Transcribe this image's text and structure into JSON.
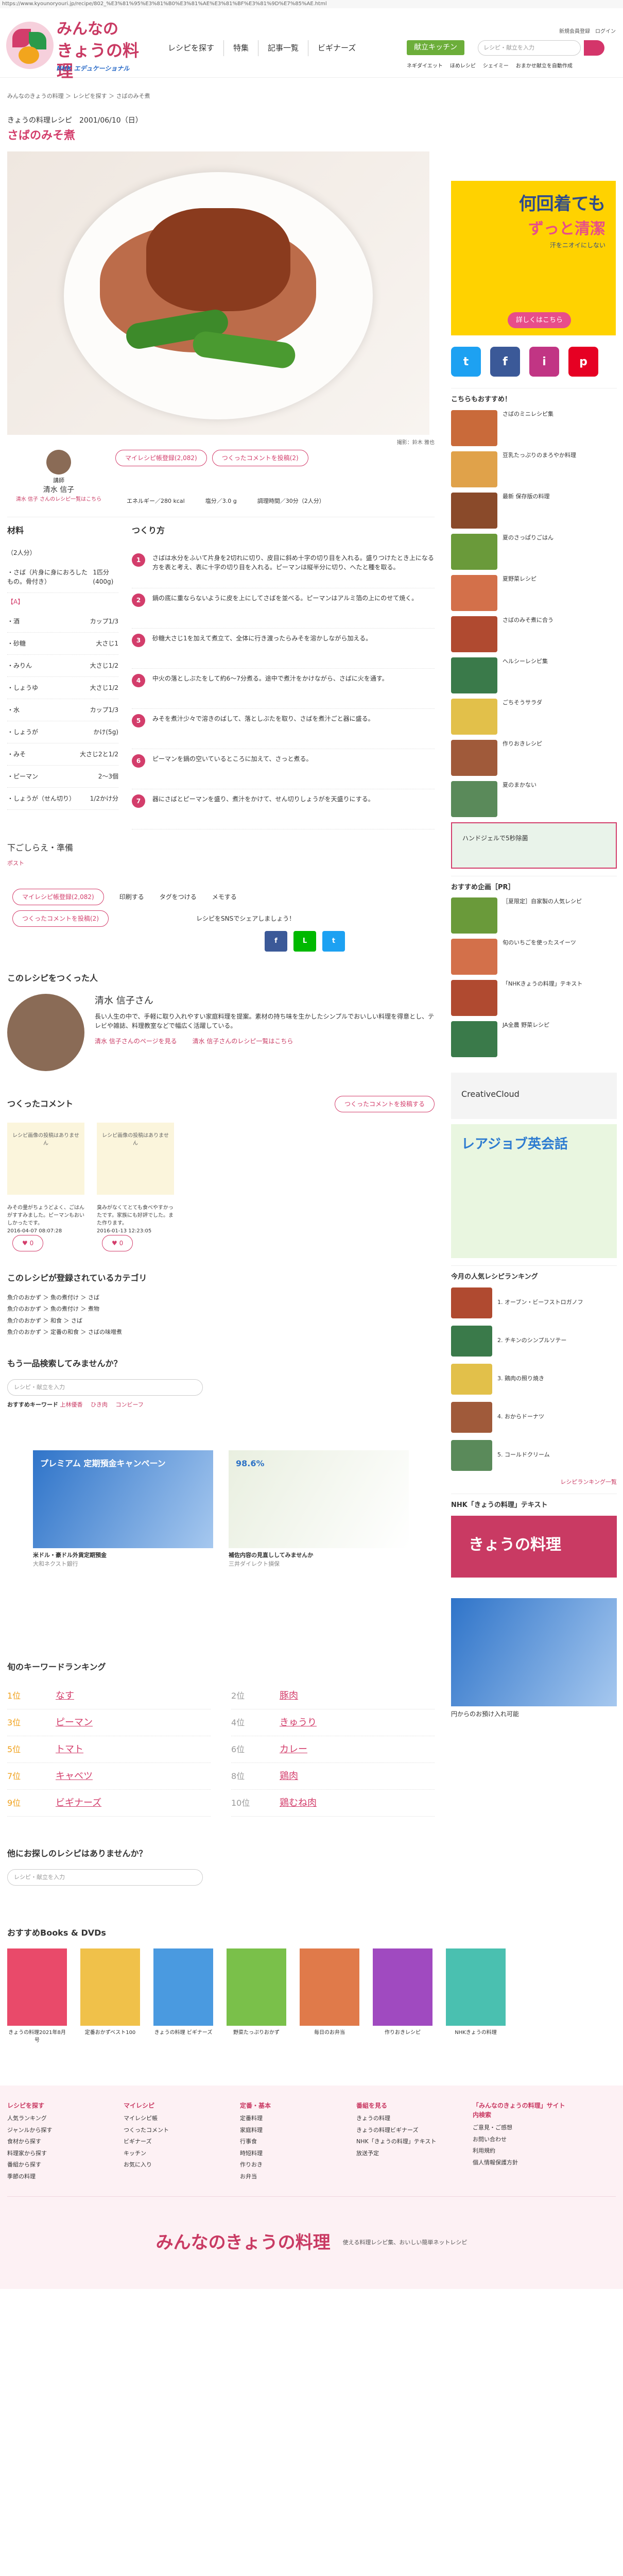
{
  "browser": {
    "url": "https://www.kyounoryouri.jp/recipe/802_%E3%81%95%E3%81%B0%E3%81%AE%E3%81%BF%E3%81%9D%E7%85%AE.html"
  },
  "header": {
    "logo_line1": "みんなの",
    "logo_line2": "きょうの料理",
    "logo_nhk": "NHK エデュケーショナル",
    "nav": [
      "レシピを探す",
      "特集",
      "記事一覧",
      "ビギナーズ"
    ],
    "top_links": "新規会員登録　ログイン",
    "kitchen_btn": "献立キッチン",
    "search_placeholder": "レシピ・献立を入力",
    "sub_links": [
      "ネギダイエット",
      "ほめレシピ",
      "シェイミー",
      "おまかせ献立を自動作成"
    ]
  },
  "breadcrumb": "みんなのきょうの料理 ＞ レシピを探す ＞ さばのみそ煮",
  "recipe": {
    "kind": "きょうの料理レシピ　2001/06/10（日）",
    "title": "さばのみそ煮",
    "photo_credit": "撮影：鈴木 雅也",
    "cook_label": "講師",
    "cook_name": "清水 信子",
    "cook_link": "清水 信子 さんのレシピ一覧はこちら",
    "fav_btn": "マイレシピ帳登録(2,082)",
    "comment_btn": "つくったコメントを投稿(2)",
    "energy": "エネルギー／280 kcal",
    "salt": "塩分／3.0 g",
    "time": "調理時間／30分（2人分）",
    "ingredients_title": "材料",
    "servings": "（2人分）",
    "ingredients": [
      {
        "name": "・さば（片身に身におろしたもの。骨付き）",
        "qty": "1匹分(400g)"
      },
      {
        "group": "【A】"
      },
      {
        "name": "・酒",
        "qty": "カップ1/3"
      },
      {
        "name": "・砂糖",
        "qty": "大さじ1"
      },
      {
        "name": "・みりん",
        "qty": "大さじ1/2"
      },
      {
        "name": "・しょうゆ",
        "qty": "大さじ1/2"
      },
      {
        "name": "・水",
        "qty": "カップ1/3"
      },
      {
        "name": "・しょうが",
        "qty": "かけ(5g)"
      },
      {
        "name": "・みそ",
        "qty": "大さじ2と1/2"
      },
      {
        "name": "・ピーマン",
        "qty": "2〜3個"
      },
      {
        "name": "・しょうが（せん切り）",
        "qty": "1/2かけ分"
      }
    ],
    "steps_title": "つくり方",
    "steps": [
      "さばは水分をふいて片身を2切れに切り、皮目に斜め十字の切り目を入れる。盛りつけたとき上になる方を表と考え、表に十字の切り目を入れる。ピーマンは縦半分に切り、へたと種を取る。",
      "鍋の底に重ならないように皮を上にしてさばを並べる。ピーマンはアルミ箔の上にのせて焼く。",
      "砂糖大さじ1を加えて煮立て、全体に行き渡ったらみそを溶かしながら加える。",
      "中火の落としぶたをして約6〜7分煮る。途中で煮汁をかけながら、さばに火を通す。",
      "みそを煮汁少々で溶きのばして、落としぶたを取り、さばを煮汁ごと器に盛る。",
      "ピーマンを鍋の空いているところに加えて、さっと煮る。",
      "器にさばとピーマンを盛り、煮汁をかけて、せん切りしょうがを天盛りにする。"
    ],
    "prep_title": "下ごしらえ・準備",
    "prep_link": "ポスト"
  },
  "actions": {
    "fav": "マイレシピ帳登録(2,082)",
    "comment": "つくったコメントを投稿(2)",
    "print": "印刷する",
    "tag": "タグをつける",
    "memo": "メモする",
    "share_label": "レシピをSNSでシェアしましょう！"
  },
  "author_section": {
    "title": "このレシピをつくった人",
    "name": "清水 信子さん",
    "bio": "長い人生の中で、手軽に取り入れやすい家庭料理を提案。素材の持ち味を生かしたシンプルでおいしい料理を得意とし、テレビや雑誌、料理教室などで幅広く活躍している。",
    "link1": "清水 信子さんのページを見る",
    "link2": "清水 信子さんのレシピ一覧はこちら"
  },
  "comments": {
    "title": "つくったコメント",
    "btn": "つくったコメントを投稿する",
    "items": [
      {
        "card": "レシピ画像の投稿はありません",
        "body": "みその量がちょうどよく、ごはんがすすみました。ピーマンもおいしかったです。",
        "date": "2016-04-07 08:07:28",
        "like": "0"
      },
      {
        "card": "レシピ画像の投稿はありません",
        "body": "臭みがなくてとても食べやすかったです。家族にも好評でした。また作ります。",
        "date": "2016-01-13 12:23:05",
        "like": "0"
      }
    ]
  },
  "categories": {
    "title": "このレシピが登録されているカテゴリ",
    "items": [
      "魚介のおかず ＞ 魚の煮付け ＞ さば",
      "魚介のおかず ＞ 魚の煮付け ＞ 煮物",
      "魚介のおかず ＞ 和食 ＞ さば",
      "魚介のおかず ＞ 定番の和食 ＞ さばの味噌煮"
    ]
  },
  "search_again": {
    "title": "もう一品検索してみませんか？",
    "placeholder": "レシピ・献立を入力",
    "kw_label": "おすすめキーワード",
    "kws": [
      "上林優香",
      "ひき肉",
      "コンビーフ"
    ]
  },
  "ads": [
    {
      "head": "プレミアム 定期預金キャンペーン",
      "caption": "米ドル・豪ドル外貨定期預金",
      "src": "大和ネクスト銀行"
    },
    {
      "head": "98.6%",
      "caption": "補佐内容の見直ししてみませんか",
      "src": "三井ダイレクト損保"
    }
  ],
  "ranking": {
    "title": "旬のキーワードランキング",
    "items": [
      {
        "no": "1位",
        "kw": "なす"
      },
      {
        "no": "2位",
        "kw": "豚肉"
      },
      {
        "no": "3位",
        "kw": "ピーマン"
      },
      {
        "no": "4位",
        "kw": "きゅうり"
      },
      {
        "no": "5位",
        "kw": "トマト"
      },
      {
        "no": "6位",
        "kw": "カレー"
      },
      {
        "no": "7位",
        "kw": "キャベツ"
      },
      {
        "no": "8位",
        "kw": "鶏肉"
      },
      {
        "no": "9位",
        "kw": "ビギナーズ"
      },
      {
        "no": "10位",
        "kw": "鶏むね肉"
      }
    ]
  },
  "search_bottom": {
    "title": "他にお探しのレシピはありませんか？",
    "placeholder": "レシピ・献立を入力"
  },
  "books": {
    "title": "おすすめBooks & DVDs",
    "items": [
      "きょうの料理2021年8月号",
      "定番おかずベスト100",
      "きょうの料理 ビギナーズ",
      "野菜たっぷりおかず",
      "毎日のお弁当",
      "作りおきレシピ",
      "NHKきょうの料理"
    ]
  },
  "sidebar": {
    "ad_big": "何回着ても",
    "ad_mid": "ずっと清潔",
    "ad_sub": "汗をニオイにしない",
    "ad_btn": "詳しくはこちら",
    "sns": [
      "t",
      "f",
      "i",
      "p"
    ],
    "pick_title": "こちらもおすすめ！",
    "picks": [
      "さばのミニレシピ集",
      "豆乳たっぷりのまろやか料理",
      "最新 保存版の料理",
      "夏のさっぱりごはん",
      "夏野菜レシピ",
      "さばのみそ煮に合う",
      "ヘルシーレシピ集",
      "ごちそうサラダ",
      "作りおきレシピ",
      "夏のまかない"
    ],
    "ad_link": "ハンドジェルで5秒除菌",
    "pr_title": "おすすめ企画［PR］",
    "pr_items": [
      "［夏限定］自家製の人気レシピ",
      "旬のいちごを使ったスイーツ",
      "「NHKきょうの料理」テキスト",
      "JA全農 野菜レシピ"
    ],
    "adobe": "CreativeCloud",
    "eng_ad": "レアジョブ英会話",
    "rank_title": "今月の人気レシピランキング",
    "ranks": [
      "オーブン・ビーフストロガノフ",
      "チキンのシンプルソテー",
      "鶏肉の照り焼き",
      "おからドーナツ",
      "コールドクリーム"
    ],
    "rank_more": "レシピランキング一覧",
    "text_title": "NHK「きょうの料理」テキスト",
    "text_logo": "きょうの料理",
    "bottom_ad": "円からのお預け入れ可能"
  },
  "footer": {
    "cols": [
      {
        "h": "レシピを探す",
        "items": [
          "人気ランキング",
          "ジャンルから探す",
          "食材から探す",
          "料理家から探す",
          "番組から探す",
          "季節の料理"
        ]
      },
      {
        "h": "マイレシピ",
        "items": [
          "マイレシピ帳",
          "つくったコメント",
          "ビギナーズ",
          "キッチン",
          "お気に入り"
        ]
      },
      {
        "h": "定番・基本",
        "items": [
          "定番料理",
          "家庭料理",
          "行事食",
          "時短料理",
          "作りおき",
          "お弁当"
        ]
      },
      {
        "h": "番組を見る",
        "items": [
          "きょうの料理",
          "きょうの料理ビギナーズ",
          "NHK「きょうの料理」テキスト",
          "放送予定"
        ]
      },
      {
        "h": "「みんなのきょうの料理」サイト内検索",
        "items": [
          "ご意見・ご感想",
          "お問い合わせ",
          "利用規約",
          "個人情報保護方針"
        ]
      }
    ],
    "logo": "みんなのきょうの料理",
    "tagline": "使える料理レシピ集、おいしい簡単ネットレシピ"
  },
  "colors": {
    "brand": "#d33d6b",
    "green": "#6cae3a",
    "gold": "#f0a01a"
  }
}
